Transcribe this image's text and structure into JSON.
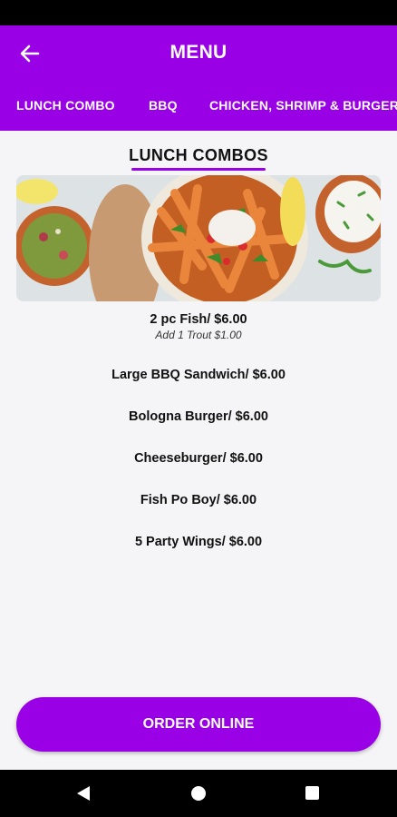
{
  "app_bar": {
    "title": "MENU",
    "back_icon": "arrow-left-icon",
    "background_color": "#9a00e6",
    "tabs": [
      {
        "label": "LUNCH COMBO",
        "selected": true
      },
      {
        "label": "BBQ",
        "selected": false
      },
      {
        "label": "CHICKEN, SHRIMP & BURGERS",
        "selected": false
      }
    ]
  },
  "section": {
    "title": "LUNCH COMBOS",
    "items": [
      {
        "name": "2 pc Fish/ $6.00",
        "note": "Add 1 Trout $1.00"
      },
      {
        "name": "Large BBQ Sandwich/ $6.00"
      },
      {
        "name": "Bologna Burger/ $6.00"
      },
      {
        "name": "Cheeseburger/ $6.00"
      },
      {
        "name": "Fish Po Boy/ $6.00"
      },
      {
        "name": "5 Party Wings/ $6.00"
      }
    ]
  },
  "order_button": {
    "label": "ORDER ONLINE"
  },
  "nav": {
    "icons": [
      "back-triangle-icon",
      "home-circle-icon",
      "recents-square-icon"
    ]
  }
}
